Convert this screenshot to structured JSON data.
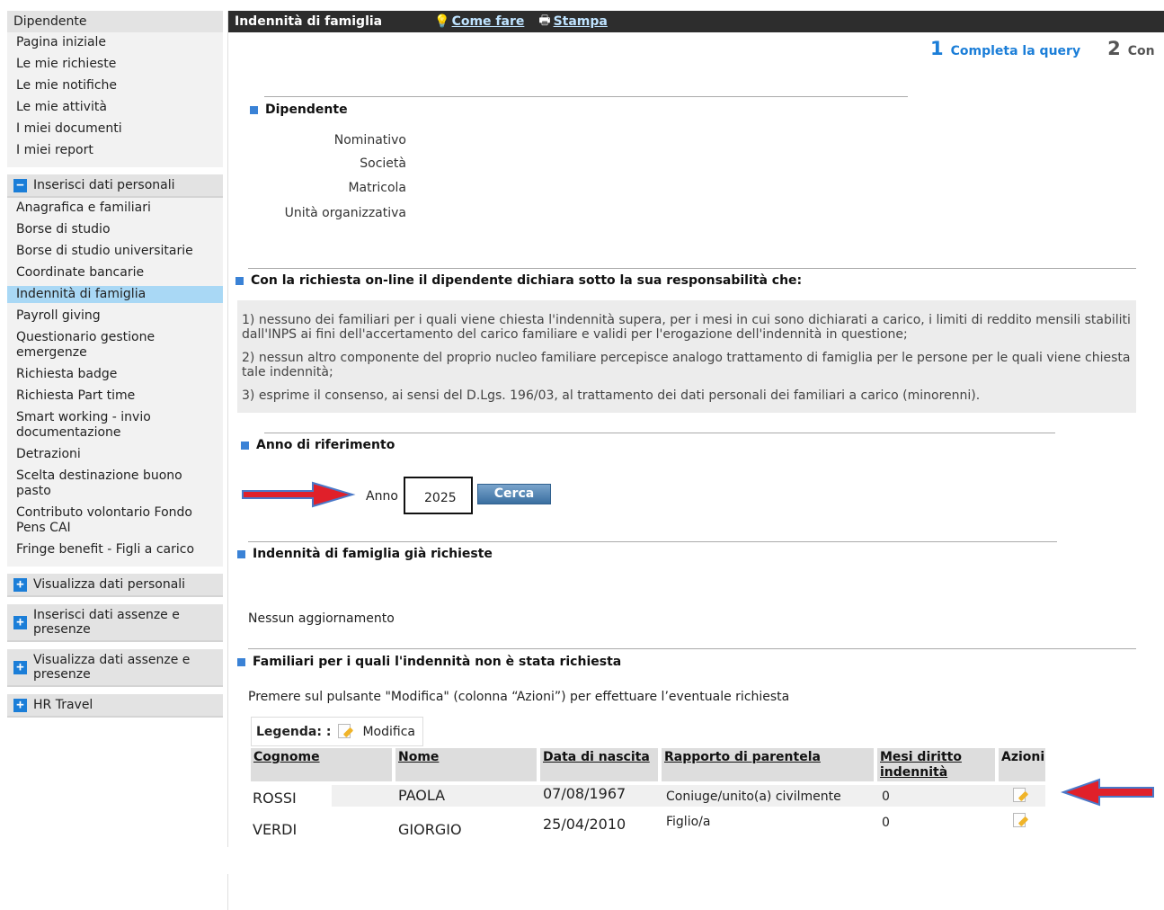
{
  "sidebar": {
    "header": "Dipendente",
    "home_items": [
      "Pagina iniziale",
      "Le mie richieste",
      "Le mie notifiche",
      "Le mie attività",
      "I miei documenti",
      "I miei report"
    ],
    "section_inserisci": "Inserisci dati personali",
    "inserisci_items": [
      "Anagrafica e familiari",
      "Borse di studio",
      "Borse di studio universitarie",
      "Coordinate bancarie",
      "Indennità di famiglia",
      "Payroll giving",
      "Questionario gestione emergenze",
      "Richiesta badge",
      "Richiesta Part time",
      "Smart working - invio documentazione",
      "Detrazioni",
      "Scelta destinazione buono pasto",
      "Contributo volontario Fondo Pens CAI",
      "Fringe benefit - Figli a carico"
    ],
    "active_item": "Indennità di famiglia",
    "section_visualizza": "Visualizza dati personali",
    "section_ins_assenze": "Inserisci dati assenze e presenze",
    "section_vis_assenze": "Visualizza dati assenze e presenze",
    "section_travel": "HR Travel",
    "minus_sign": "−",
    "plus_sign": "+"
  },
  "topbar": {
    "title": "Indennità di famiglia",
    "help_icon_glyph": "💡",
    "help_label": "Come fare",
    "print_icon_glyph": "🖶",
    "print_label": "Stampa"
  },
  "steps": [
    {
      "num": "1",
      "label": "Completa la query",
      "color": "#1b7ed8"
    },
    {
      "num": "2",
      "label": "Con",
      "color": "#555555"
    }
  ],
  "dipendente": {
    "title": "Dipendente",
    "labels": [
      "Nominativo",
      "Società",
      "Matricola",
      "Unità organizzativa"
    ]
  },
  "dichiarazione": {
    "title": "Con la richiesta on-line il dipendente dichiara sotto la sua responsabilità che:",
    "points": [
      "1) nessuno dei familiari per i quali viene chiesta l'indennità supera, per i mesi in cui sono dichiarati a carico, i limiti di reddito mensili stabiliti dall'INPS ai fini dell'accertamento del carico familiare e validi per l'erogazione dell'indennità in questione;",
      "2) nessun altro componente del proprio nucleo familiare percepisce analogo trattamento di famiglia per le persone per le quali viene chiesta tale indennità;",
      "3) esprime il consenso, ai sensi del D.Lgs. 196/03, al trattamento dei dati personali dei familiari a carico (minorenni)."
    ]
  },
  "anno": {
    "title": "Anno di riferimento",
    "label": "Anno",
    "value": "2025",
    "button": "Cerca"
  },
  "gia_richieste": {
    "title": "Indennità di famiglia già richieste",
    "empty": "Nessun aggiornamento"
  },
  "non_richieste": {
    "title": "Familiari per i quali l'indennità non è stata richiesta",
    "hint": "Premere sul pulsante \"Modifica\" (colonna “Azioni”) per effettuare l’eventuale richiesta",
    "legend_label": "Legenda: :",
    "legend_modifica": "Modifica",
    "columns": [
      "Cognome",
      "Nome",
      "Data di nascita",
      "Rapporto di parentela",
      "Mesi diritto indennità",
      "Azioni"
    ],
    "rows": [
      {
        "cognome": "ROSSI",
        "nome": "PAOLA",
        "data": "07/08/1967",
        "rapporto": "Coniuge/unito(a) civilmente",
        "mesi": "0"
      },
      {
        "cognome": "VERDI",
        "nome": "GIORGIO",
        "data": "25/04/2010",
        "rapporto": "Figlio/a",
        "mesi": "0"
      }
    ]
  },
  "colors": {
    "accent": "#1b7ed8",
    "arrow": "#e0202a",
    "active_bg": "#a9d8f5",
    "topbar_bg": "#2d2d2d"
  }
}
